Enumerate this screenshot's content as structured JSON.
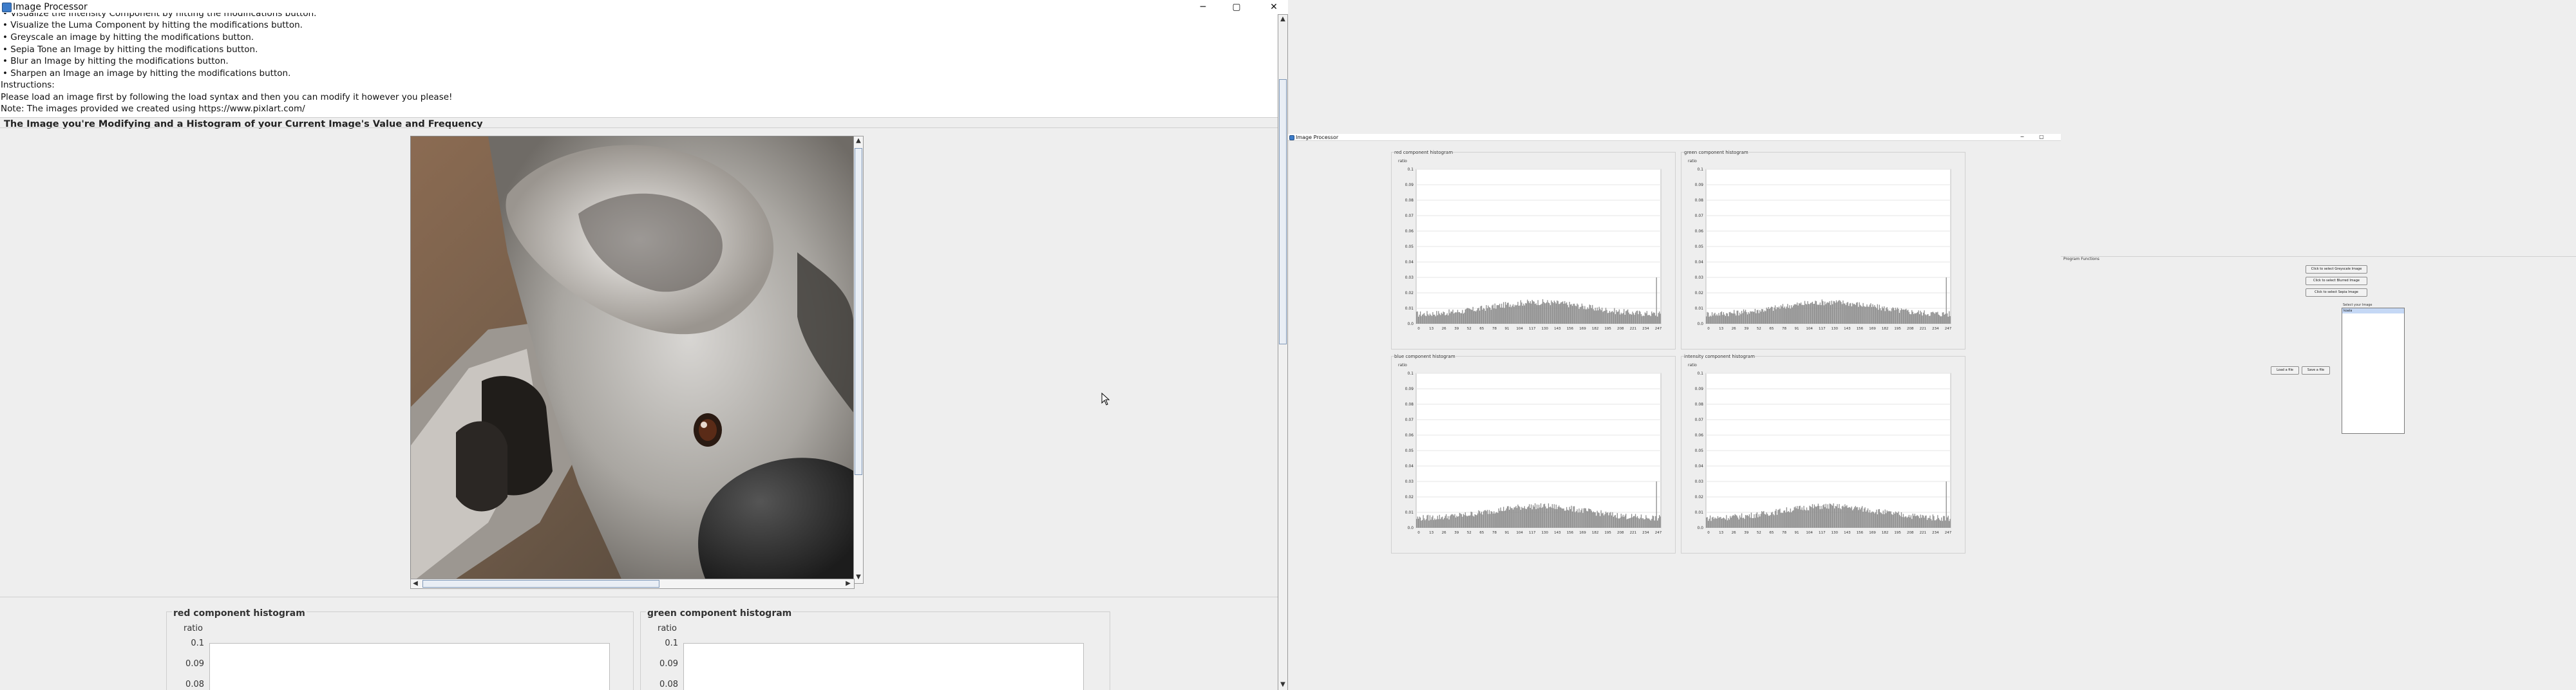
{
  "main_window": {
    "title": "Image Processor",
    "controls": {
      "minimize": "─",
      "maximize": "▢",
      "close": "✕"
    },
    "instructions": {
      "lines": [
        "• Visualize the Intensity Component by hitting the modifications button.",
        "• Visualize the Luma Component by hitting the modifications button.",
        "• Greyscale an image by hitting the modifications button.",
        "• Sepia Tone an Image by hitting the modifications button.",
        "• Blur an Image by hitting the modifications button.",
        "• Sharpen an Image an image by hitting the modifications button.",
        "Instructions:",
        "Please load an image first by following the load syntax and then you can modify it however you please!",
        "Note: The images provided we created using https://www.pixlart.com/"
      ]
    },
    "section_title": "The Image you're Modifying and a Histogram of your Current Image's Value and Frequency",
    "image_alt": "koala",
    "histograms": {
      "red": {
        "title": "red component histogram",
        "ylabel": "ratio",
        "ticks": [
          "0.1",
          "0.09",
          "0.08"
        ]
      },
      "green": {
        "title": "green component histogram",
        "ylabel": "ratio",
        "ticks": [
          "0.1",
          "0.09",
          "0.08"
        ]
      }
    }
  },
  "secondary_window": {
    "title": "Image Processor",
    "controls": {
      "minimize": "─",
      "maximize": "▢"
    },
    "y_ticks": [
      "0.1",
      "0.09",
      "0.08",
      "0.07",
      "0.06",
      "0.05",
      "0.04",
      "0.03",
      "0.02",
      "0.01",
      "0.0"
    ],
    "x_ticks": [
      "0",
      "13",
      "26",
      "39",
      "52",
      "65",
      "78",
      "91",
      "104",
      "117",
      "130",
      "143",
      "156",
      "169",
      "182",
      "195",
      "208",
      "221",
      "234",
      "247"
    ],
    "ylabel": "ratio",
    "histograms": [
      {
        "title": "red component histogram"
      },
      {
        "title": "green component histogram"
      },
      {
        "title": "blue component histogram"
      },
      {
        "title": "intensity component histogram"
      }
    ]
  },
  "functions_panel": {
    "title": "Program Functions",
    "buttons": {
      "greyscale": "Click to select Greyscale Image",
      "blur": "Click to select Blurred Image",
      "sepia": "Click to select Sepia Image",
      "load": "Load a file",
      "save": "Save a file"
    },
    "list_title": "Select your Image",
    "list_selected": "koala"
  },
  "colors": {
    "window_bg": "#eeeeee",
    "panel_bg": "#ffffff",
    "bar": "#8c8c8c",
    "selection": "#c5d8f5"
  }
}
